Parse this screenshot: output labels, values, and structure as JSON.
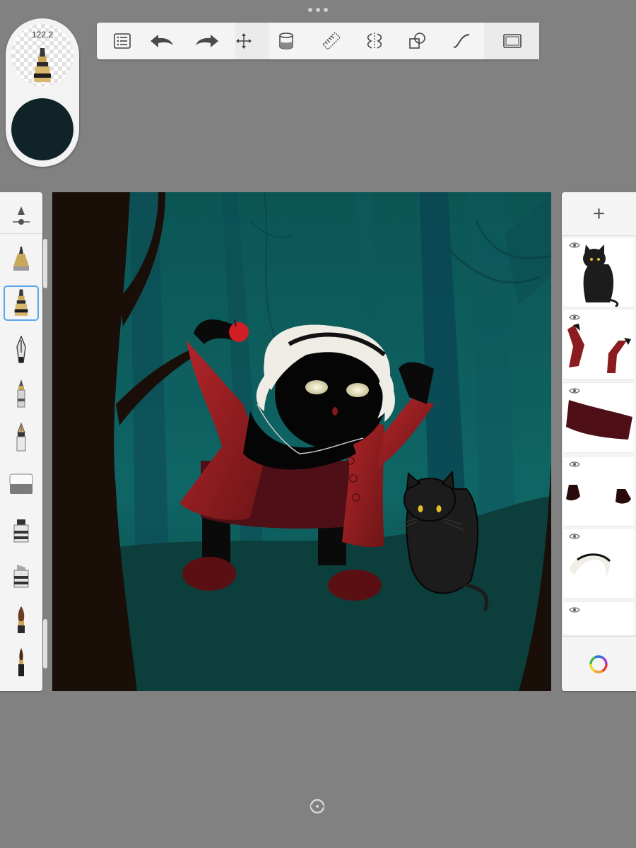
{
  "app": {
    "brush_size_value": "122.2",
    "current_color": "#0f2329"
  },
  "toolbar": {
    "tools": [
      "layers-list",
      "undo",
      "redo",
      "transform",
      "fill",
      "ruler",
      "symmetry",
      "shapes",
      "stroke-style",
      "fullscreen"
    ]
  },
  "brush_library": {
    "brushes": [
      "pencil",
      "marker",
      "ink-pen",
      "ballpoint",
      "fountain-pen",
      "eraser",
      "flat-marker",
      "chisel-marker",
      "round-brush",
      "paint-brush"
    ],
    "selected": "marker"
  },
  "layers": {
    "add_label": "+",
    "items": [
      "black-cat",
      "sleeves",
      "skirt",
      "boots",
      "headband",
      "empty-layer"
    ]
  },
  "colors": {
    "background": "#818181",
    "panel": "#f4f4f4",
    "canvas_bg": "#0e5859",
    "selection": "#5ba6ea"
  }
}
